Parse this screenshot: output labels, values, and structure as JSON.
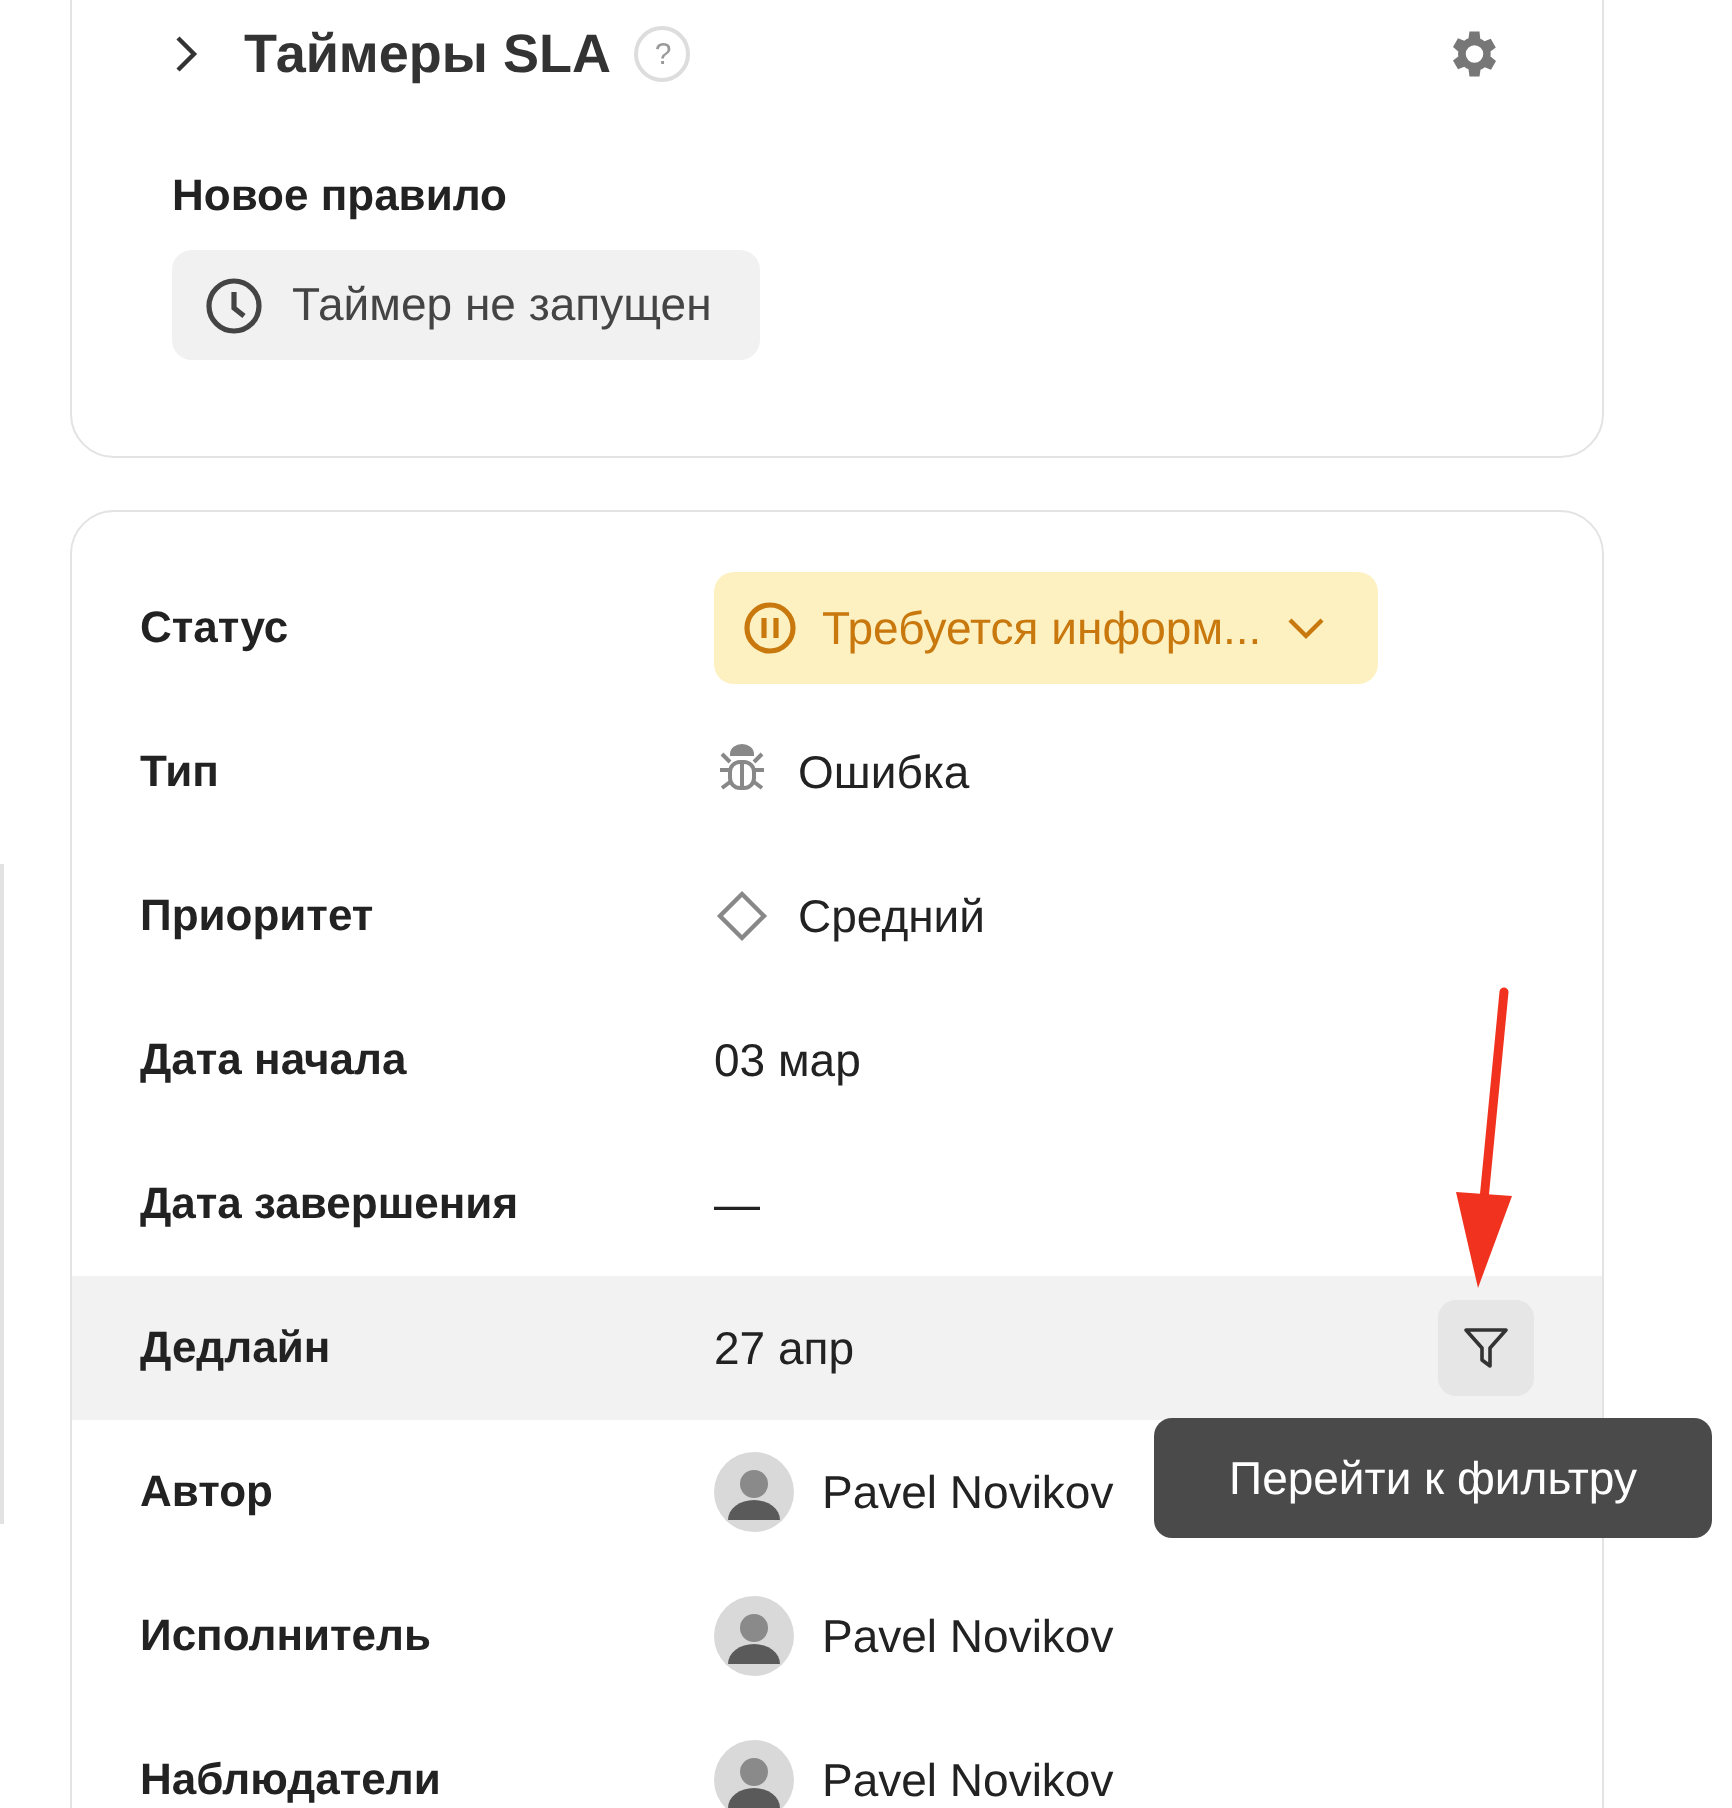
{
  "sla_card": {
    "title": "Таймеры SLA",
    "help": "?",
    "expanded": false,
    "rule": {
      "title": "Новое правило",
      "timer": "Таймер не запущен"
    }
  },
  "fields": [
    {
      "kind": "status",
      "label": "Статус",
      "value": "Требуется информ..."
    },
    {
      "kind": "bug",
      "label": "Тип",
      "value": "Ошибка"
    },
    {
      "kind": "diamond",
      "label": "Приоритет",
      "value": "Средний"
    },
    {
      "kind": "text",
      "label": "Дата начала",
      "value": "03 мар"
    },
    {
      "kind": "text",
      "label": "Дата завершения",
      "value": "—"
    },
    {
      "kind": "text",
      "label": "Дедлайн",
      "value": "27 апр",
      "hovered": true,
      "tooltip": "Перейти к фильтру"
    },
    {
      "kind": "user",
      "label": "Автор",
      "value": "Pavel Novikov"
    },
    {
      "kind": "user",
      "label": "Исполнитель",
      "value": "Pavel Novikov"
    },
    {
      "kind": "user",
      "label": "Наблюдатели",
      "value": "Pavel Novikov"
    }
  ]
}
